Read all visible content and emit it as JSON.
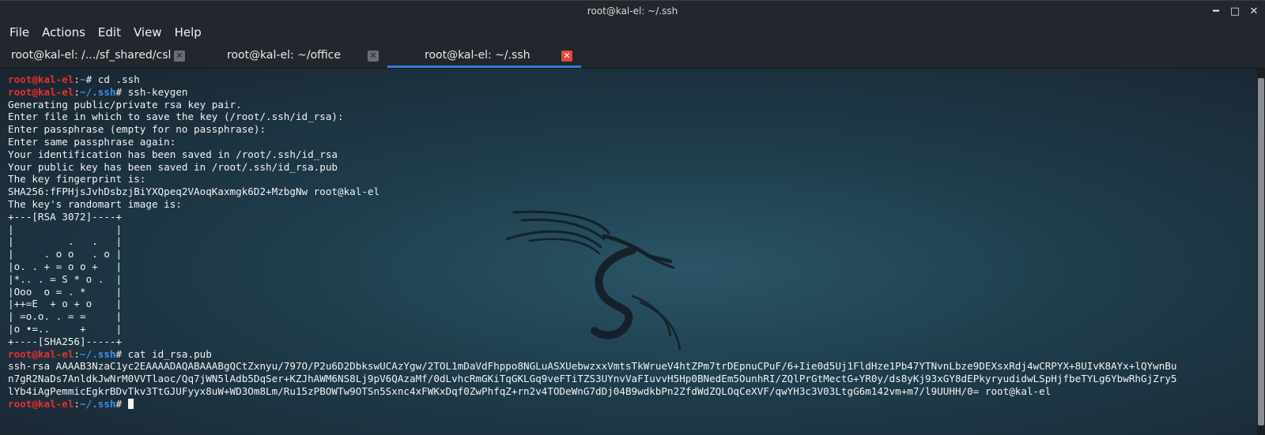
{
  "window": {
    "title": "root@kal-el: ~/.ssh",
    "controls": {
      "minimize": "━",
      "maximize": "□",
      "close": "✕"
    }
  },
  "menu": [
    "File",
    "Actions",
    "Edit",
    "View",
    "Help"
  ],
  "tabs": [
    {
      "label": "root@kal-el: /.../sf_shared/csl",
      "close": "✕"
    },
    {
      "label": "root@kal-el: ~/office",
      "close": "✕"
    },
    {
      "label": "root@kal-el: ~/.ssh",
      "close": "✕",
      "active": true
    }
  ],
  "terminal": {
    "prompts": {
      "user": "root@kal-el",
      "sep": ":",
      "home": "~",
      "ssh": "~/.ssh",
      "hash": "# "
    },
    "commands": {
      "cd": "cd .ssh",
      "keygen": "ssh-keygen",
      "cat": "cat id_rsa.pub"
    },
    "output": [
      "Generating public/private rsa key pair.",
      "Enter file in which to save the key (/root/.ssh/id_rsa):",
      "Enter passphrase (empty for no passphrase):",
      "Enter same passphrase again:",
      "Your identification has been saved in /root/.ssh/id_rsa",
      "Your public key has been saved in /root/.ssh/id_rsa.pub",
      "The key fingerprint is:",
      "SHA256:fFPHjsJvhDsbzjBiYXQpeq2VAoqKaxmgk6D2+MzbgNw root@kal-el",
      "The key's randomart image is:",
      "+---[RSA 3072]----+",
      "|                 |",
      "|         .   .   |",
      "|     . o o   . o |",
      "|o. . + = o o +   |",
      "|*.. . = S * o .  |",
      "|Ooo  o = . *     |",
      "|++=E  + o + o    |",
      "| =o.o. . = =     |",
      "|o •=..     +     |",
      "+----[SHA256]-----+"
    ],
    "pubkey": [
      "ssh-rsa AAAAB3NzaC1yc2EAAAADAQABAAABgQCtZxnyu/797O/P2u6D2DbkswUCAzYgw/2TOL1mDaVdFhppo8NGLuASXUebwzxxVmtsTkWrueV4htZPm7trDEpnuCPuF/6+Iie0d5Uj1FldHze1Pb47YTNvnLbze9DEXsxRdj4wCRPYX+8UIvK8AYx+lQYwnBu",
      "n7gR2NaDs7AnldkJwNrM0VVTlaoc/Qq7jWN5lAdb5DqSer+KZJhAWM6NS8Lj9pV6QAzaMf/0dLvhcRmGKiTqGKLGq9veFTiTZS3UYnvVaFIuvvH5Hp0BNedEm5OunhRI/ZQlPrGtMectG+YR0y/ds8yKj93xGY8dEPkyryudidwLSpHjfbeTYLg6YbwRhGjZry5",
      "lYb4iAgPemmicEgkrBDvTkv3TtGJUFyyx8uW+WD3Om8Lm/Ru15zPBOWTw9OTSn5Sxnc4xFWKxDqf0ZwPhfqZ+rn2v4TODeWnG7dDj04B9wdkbPn2ZfdWdZQLOqCeXVF/qwYH3c3V03LtgG6m142vm+m7/l9UUHH/0= root@kal-el"
    ]
  }
}
